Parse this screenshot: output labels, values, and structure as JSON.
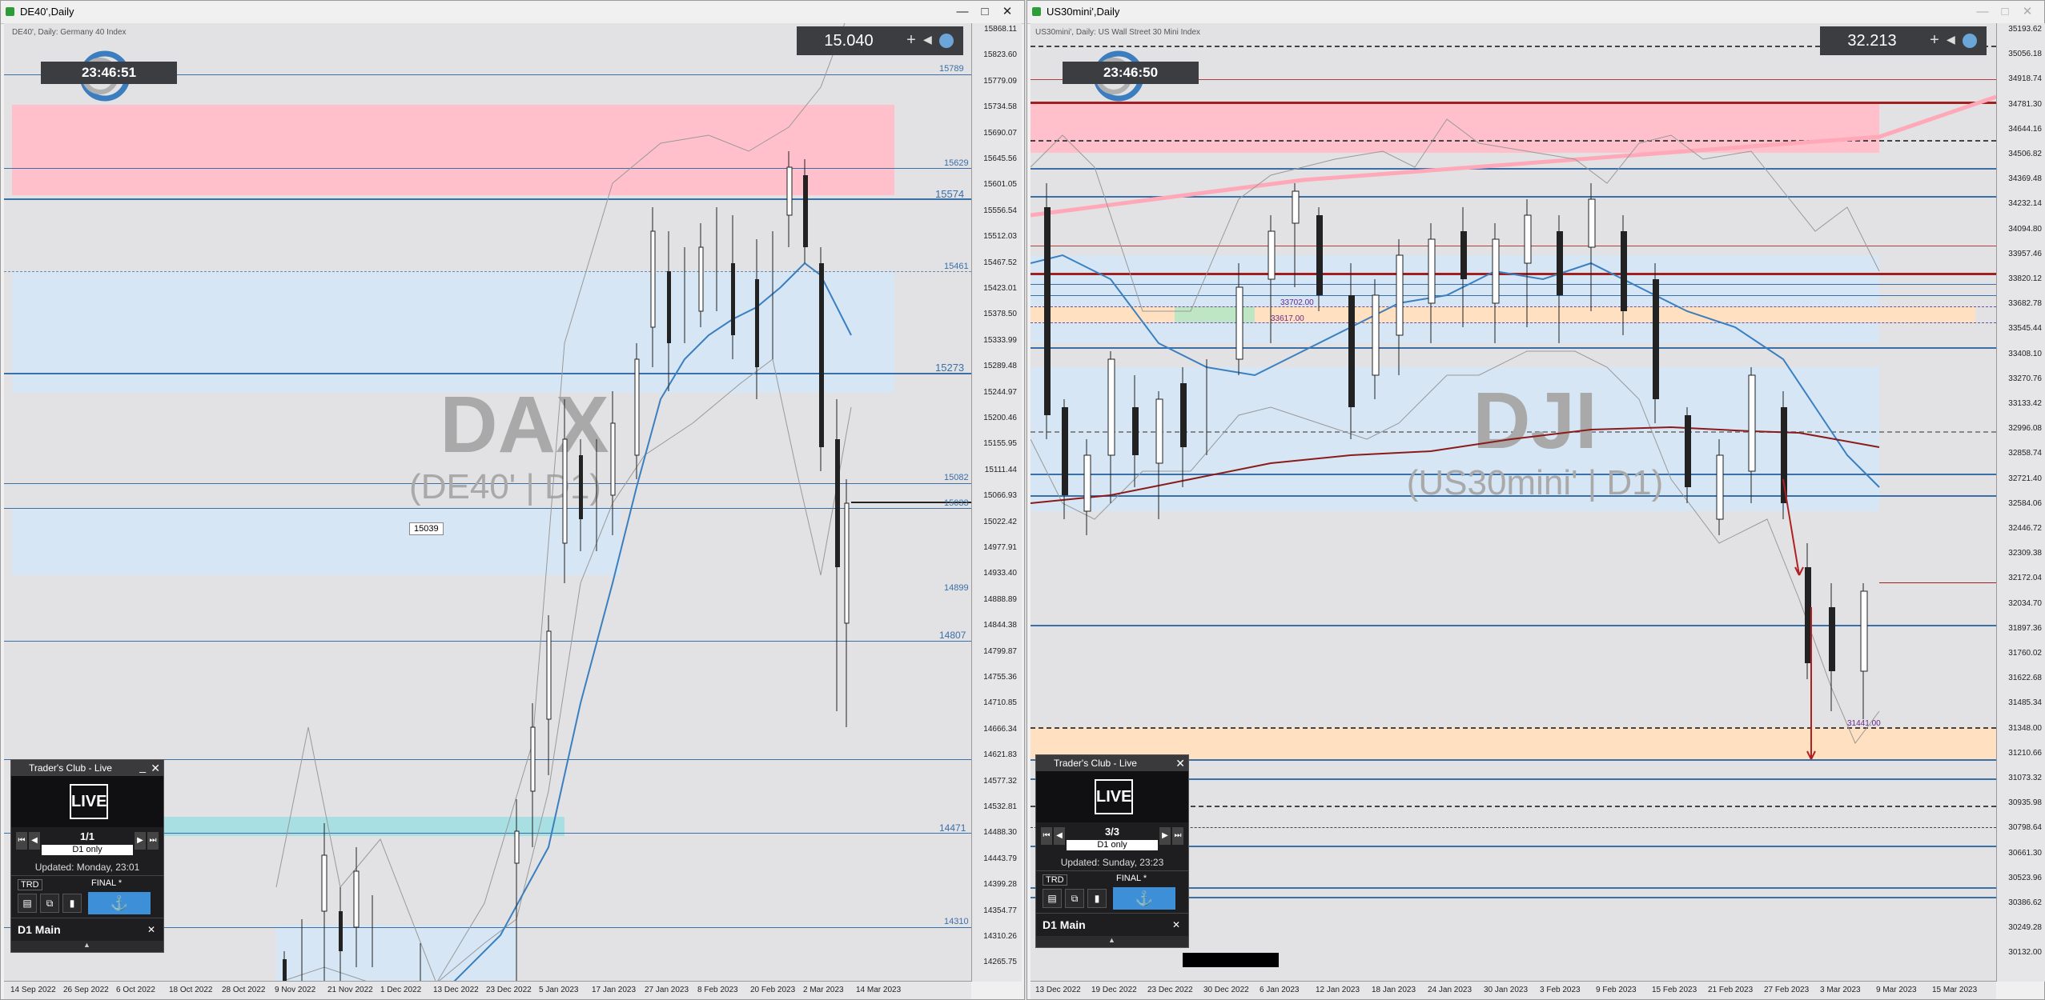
{
  "left": {
    "title": "DE40',Daily",
    "chart_header": "DE40', Daily:  Germany 40 Index",
    "clock": "23:46:51",
    "spread_value": "15.040",
    "watermark_main": "DAX",
    "watermark_sub": "(DE40' | D1)",
    "price_tag": "15039",
    "level_labels": [
      "15789",
      "15629",
      "15574",
      "15461",
      "15273",
      "15082",
      "15033",
      "14899",
      "14807",
      "14471",
      "14310"
    ],
    "price_axis": [
      "15868.11",
      "15823.60",
      "15779.09",
      "15734.58",
      "15690.07",
      "15645.56",
      "15601.05",
      "15556.54",
      "15512.03",
      "15467.52",
      "15423.01",
      "15378.50",
      "15333.99",
      "15289.48",
      "15244.97",
      "15200.46",
      "15155.95",
      "15111.44",
      "15066.93",
      "15022.42",
      "14977.91",
      "14933.40",
      "14888.89",
      "14844.38",
      "14799.87",
      "14755.36",
      "14710.85",
      "14666.34",
      "14621.83",
      "14577.32",
      "14532.81",
      "14488.30",
      "14443.79",
      "14399.28",
      "14354.77",
      "14310.26",
      "14265.75"
    ],
    "date_axis": [
      "14 Sep 2022",
      "26 Sep 2022",
      "6 Oct 2022",
      "18 Oct 2022",
      "28 Oct 2022",
      "9 Nov 2022",
      "21 Nov 2022",
      "1 Dec 2022",
      "13 Dec 2022",
      "23 Dec 2022",
      "5 Jan 2023",
      "17 Jan 2023",
      "27 Jan 2023",
      "8 Feb 2023",
      "20 Feb 2023",
      "2 Mar 2023",
      "14 Mar 2023"
    ],
    "panel": {
      "header": "Trader's Club - Live",
      "live": "LIVE",
      "page": "1/1",
      "sub": "D1 only",
      "updated": "Updated: Monday, 23:01",
      "trd": "TRD",
      "final": "FINAL *",
      "main": "D1 Main"
    }
  },
  "right": {
    "title": "US30mini',Daily",
    "chart_header": "US30mini', Daily:  US Wall Street 30 Mini Index",
    "clock": "23:46:50",
    "spread_value": "32.213",
    "watermark_main": "DJI",
    "watermark_sub": "(US30mini' | D1)",
    "level_labels": [
      "33702.00",
      "33617.00",
      "31441.00"
    ],
    "price_axis": [
      "35193.62",
      "35056.18",
      "34918.74",
      "34781.30",
      "34644.16",
      "34506.82",
      "34369.48",
      "34232.14",
      "34094.80",
      "33957.46",
      "33820.12",
      "33682.78",
      "33545.44",
      "33408.10",
      "33270.76",
      "33133.42",
      "32996.08",
      "32858.74",
      "32721.40",
      "32584.06",
      "32446.72",
      "32309.38",
      "32172.04",
      "32034.70",
      "31897.36",
      "31760.02",
      "31622.68",
      "31485.34",
      "31348.00",
      "31210.66",
      "31073.32",
      "30935.98",
      "30798.64",
      "30661.30",
      "30523.96",
      "30386.62",
      "30249.28",
      "30132.00"
    ],
    "date_axis": [
      "13 Dec 2022",
      "19 Dec 2022",
      "23 Dec 2022",
      "30 Dec 2022",
      "6 Jan 2023",
      "12 Jan 2023",
      "18 Jan 2023",
      "24 Jan 2023",
      "30 Jan 2023",
      "3 Feb 2023",
      "9 Feb 2023",
      "15 Feb 2023",
      "21 Feb 2023",
      "27 Feb 2023",
      "3 Mar 2023",
      "9 Mar 2023",
      "15 Mar 2023"
    ],
    "panel": {
      "header": "Trader's Club - Live",
      "live": "LIVE",
      "page": "3/3",
      "sub": "D1 only",
      "updated": "Updated: Sunday, 23:23",
      "trd": "TRD",
      "final": "FINAL *",
      "main": "D1 Main"
    }
  },
  "colors": {
    "resistance_zone": "#ffc0cb",
    "value_zone": "#d6e6f4",
    "support_zone": "#ffe0c0",
    "teal_zone": "#a8dfe2",
    "level_line": "#3a6fa8",
    "ma_line": "#3a7fc0",
    "ma200_line": "#8b1a1a"
  }
}
